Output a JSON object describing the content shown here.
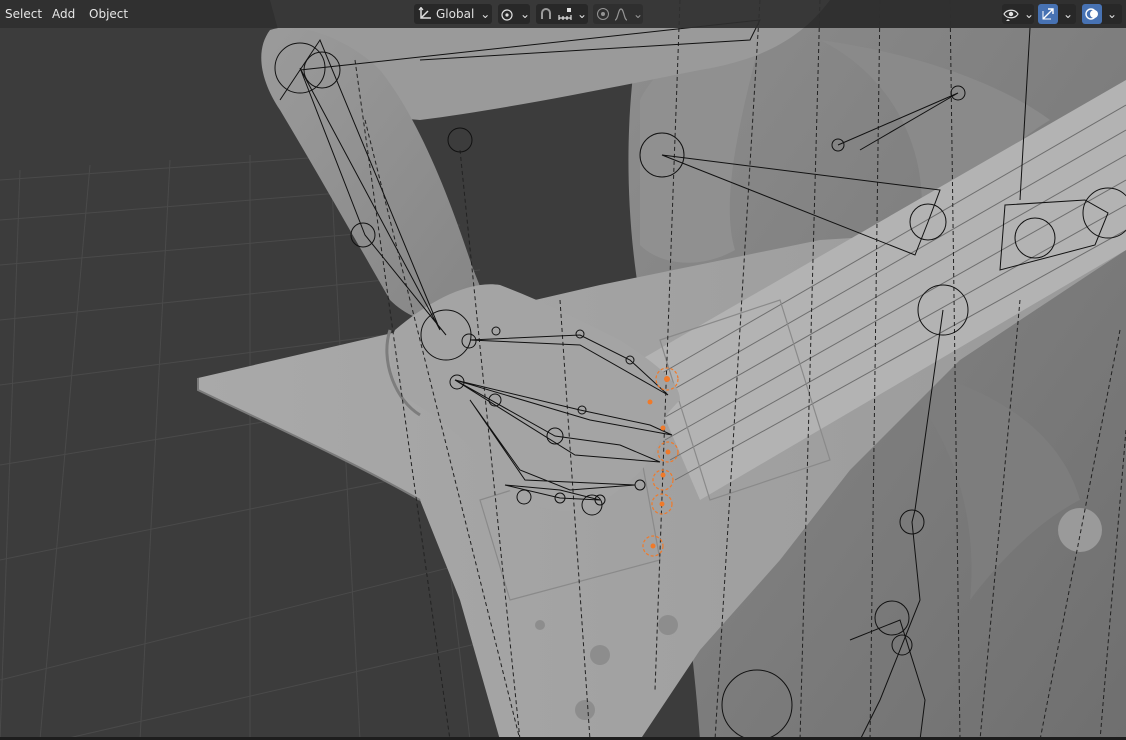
{
  "menu": {
    "select_label": "Select",
    "add_label": "Add",
    "object_label": "Object"
  },
  "toolbar": {
    "transform_orientation": "Global"
  },
  "colors": {
    "header_bg": "#303030",
    "viewport_bg": "#3c3c3c",
    "accent_blue": "#4772b3",
    "selected_bone": "#f07a2a"
  },
  "icons": [
    "orientation-icon",
    "pivot-icon",
    "snap-magnet-icon",
    "snap-increment-icon",
    "proportional-edit-icon",
    "falloff-icon",
    "visibility-eye-icon",
    "gizmo-icon",
    "overlays-icon"
  ]
}
